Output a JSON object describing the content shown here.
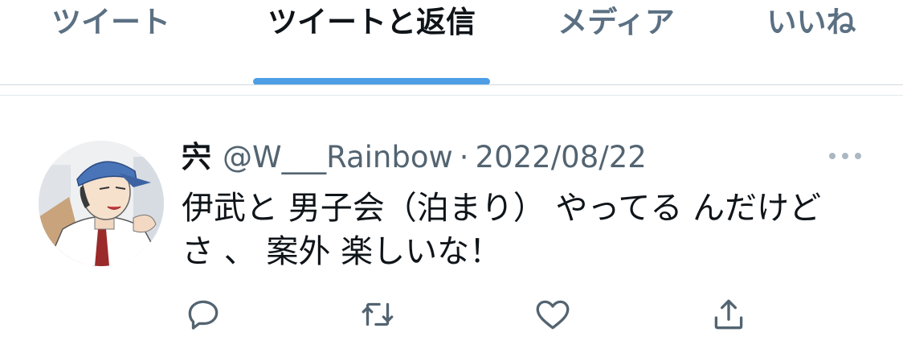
{
  "tabs": [
    {
      "label": "ツイート",
      "active": false
    },
    {
      "label": "ツイートと返信",
      "active": true
    },
    {
      "label": "メディア",
      "active": false
    },
    {
      "label": "いいね",
      "active": false
    }
  ],
  "accent_color": "#4d9ee4",
  "tweet": {
    "display_name": "宍",
    "handle": "@W___Rainbow",
    "separator": "·",
    "date": "2022/08/22",
    "text": "伊武と 男子会（泊まり） やってる んだけど\nさ 、 案外 楽しいな！",
    "more_icon": "more-horizontal-icon",
    "actions": [
      {
        "name": "reply",
        "icon": "reply-icon"
      },
      {
        "name": "retweet",
        "icon": "retweet-icon"
      },
      {
        "name": "like",
        "icon": "heart-icon"
      },
      {
        "name": "share",
        "icon": "share-icon"
      }
    ]
  }
}
